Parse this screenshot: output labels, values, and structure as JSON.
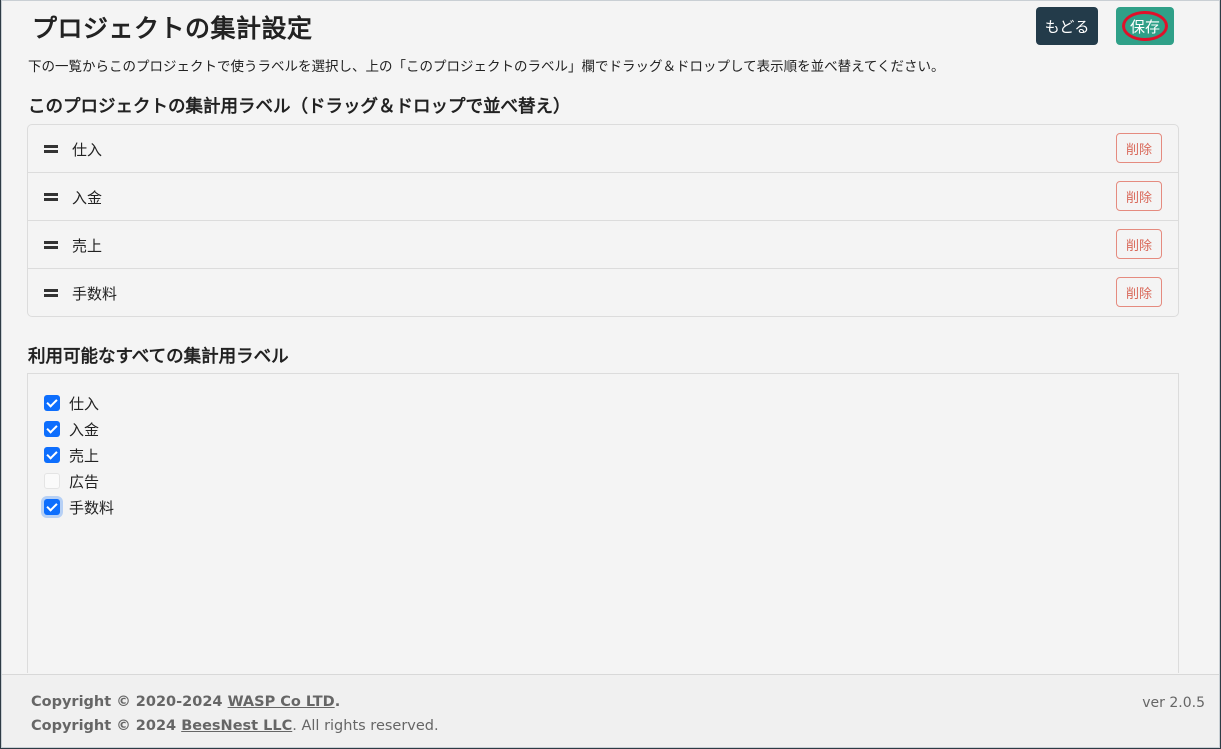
{
  "header": {
    "title": "プロジェクトの集計設定",
    "back_label": "もどる",
    "save_label": "保存"
  },
  "description": "下の一覧からこのプロジェクトで使うラベルを選択し、上の「このプロジェクトのラベル」欄でドラッグ＆ドロップして表示順を並べ替えてください。",
  "project_labels": {
    "title": "このプロジェクトの集計用ラベル（ドラッグ＆ドロップで並べ替え）",
    "delete_label": "削除",
    "items": [
      {
        "label": "仕入"
      },
      {
        "label": "入金"
      },
      {
        "label": "売上"
      },
      {
        "label": "手数料"
      }
    ]
  },
  "available_labels": {
    "title": "利用可能なすべての集計用ラベル",
    "items": [
      {
        "label": "仕入",
        "checked": true
      },
      {
        "label": "入金",
        "checked": true
      },
      {
        "label": "売上",
        "checked": true
      },
      {
        "label": "広告",
        "checked": false
      },
      {
        "label": "手数料",
        "checked": true,
        "focused": true
      }
    ]
  },
  "footer": {
    "line1_prefix": "Copyright © 2020-2024 ",
    "line1_link": "WASP Co LTD",
    "line1_suffix": ".",
    "line2_prefix": "Copyright © 2024 ",
    "line2_link": "BeesNest LLC",
    "line2_suffix": ". All rights reserved.",
    "version": "ver 2.0.5"
  },
  "colors": {
    "primary_dark": "#233b4a",
    "save_green": "#2fa088",
    "highlight_red": "#e0102a",
    "delete_red": "#d9695a",
    "checkbox_blue": "#0d6efd"
  }
}
